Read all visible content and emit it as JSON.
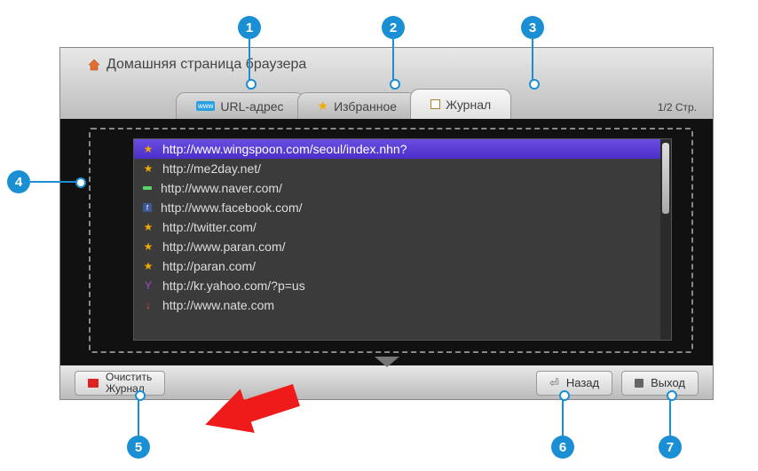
{
  "header": {
    "home_label": "Домашняя страница браузера"
  },
  "tabs": {
    "url": "URL-адрес",
    "fav": "Избранное",
    "history": "Журнал"
  },
  "page_indicator": "1/2 Стр.",
  "list": [
    {
      "icon": "star",
      "url": "http://www.wingspoon.com/seoul/index.nhn?",
      "selected": true
    },
    {
      "icon": "star",
      "url": "http://me2day.net/"
    },
    {
      "icon": "dash",
      "url": "http://www.naver.com/"
    },
    {
      "icon": "fb",
      "url": "http://www.facebook.com/"
    },
    {
      "icon": "star",
      "url": "http://twitter.com/"
    },
    {
      "icon": "star",
      "url": "http://www.paran.com/"
    },
    {
      "icon": "star",
      "url": "http://paran.com/"
    },
    {
      "icon": "ybang",
      "url": "http://kr.yahoo.com/?p=us"
    },
    {
      "icon": "down",
      "url": "http://www.nate.com"
    }
  ],
  "buttons": {
    "clear_l1": "Очистить",
    "clear_l2": "Журнал",
    "back": "Назад",
    "exit": "Выход"
  },
  "callouts": [
    "1",
    "2",
    "3",
    "4",
    "5",
    "6",
    "7"
  ]
}
